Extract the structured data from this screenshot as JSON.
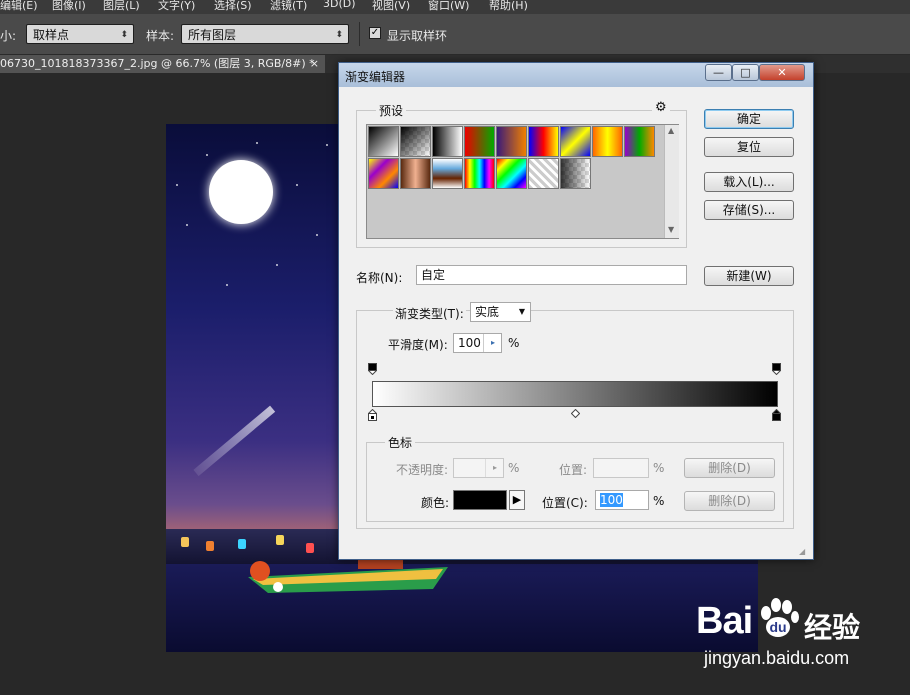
{
  "menubar": {
    "items": [
      "编辑(E)",
      "图像(I)",
      "图层(L)",
      "文字(Y)",
      "选择(S)",
      "滤镜(T)",
      "3D(D)",
      "视图(V)",
      "窗口(W)",
      "帮助(H)"
    ]
  },
  "options": {
    "size_label": "小:",
    "size_value": "取样点",
    "sample_label": "样本:",
    "sample_value": "所有图层",
    "show_ring_label": "显示取样环",
    "show_ring_checked": true
  },
  "document_tab": {
    "title": "06730_101818373367_2.jpg @ 66.7% (图层 3, RGB/8#) *",
    "close": "×"
  },
  "dialog": {
    "title": "渐变编辑器",
    "window_buttons": {
      "minimize": "—",
      "maximize": "□",
      "close": "✕"
    },
    "presets_label": "预设",
    "presets_gear": "⚙",
    "presets": [
      {
        "name": "foreground-to-background",
        "css": "linear-gradient(135deg,#000,#fff)"
      },
      {
        "name": "foreground-to-transparent",
        "css": "linear-gradient(135deg,#000,rgba(0,0,0,0))"
      },
      {
        "name": "black-white",
        "css": "linear-gradient(90deg,#000,#fff)"
      },
      {
        "name": "red-green",
        "css": "linear-gradient(90deg,#e00,#0a0)"
      },
      {
        "name": "violet-orange",
        "css": "linear-gradient(90deg,#3a1a7a,#f08000)"
      },
      {
        "name": "blue-red-yellow",
        "css": "linear-gradient(90deg,#00f,#f00,#ff0)"
      },
      {
        "name": "blue-yellow-blue",
        "css": "linear-gradient(135deg,#00f,#ff0,#00f)"
      },
      {
        "name": "orange-yellow-orange",
        "css": "linear-gradient(90deg,#f60,#ff0,#f60)"
      },
      {
        "name": "violet-green-orange",
        "css": "linear-gradient(90deg,#90c,#0a0,#f80)"
      },
      {
        "name": "yellow-violet-orange-blue",
        "css": "linear-gradient(135deg,#ff0,#90c,#f80,#00f)"
      },
      {
        "name": "copper",
        "css": "linear-gradient(90deg,#5a2a10,#f0b090,#5a2a10)"
      },
      {
        "name": "chrome",
        "css": "linear-gradient(180deg,#fff,#6ad,#620,#fff)"
      },
      {
        "name": "spectrum",
        "css": "linear-gradient(90deg,#f00,#ff0,#0f0,#0ff,#00f,#f0f,#f00)"
      },
      {
        "name": "transparent-rainbow",
        "css": "linear-gradient(135deg,#f00,#ff0,#0f0,#0ff,#00f,#f0f)"
      },
      {
        "name": "transparent-stripes",
        "css": "repeating-linear-gradient(45deg,#ccc 0 3px,#fff 3px 6px)"
      },
      {
        "name": "neutral-density",
        "css": "linear-gradient(90deg,rgba(0,0,0,.8),rgba(0,0,0,0))"
      }
    ],
    "buttons": {
      "ok": "确定",
      "reset": "复位",
      "load": "载入(L)...",
      "save": "存储(S)...",
      "new": "新建(W)"
    },
    "name_label": "名称(N):",
    "name_value": "自定",
    "gradient_type_label": "渐变类型(T):",
    "gradient_type_value": "实底",
    "smoothness_label": "平滑度(M):",
    "smoothness_value": "100",
    "percent": "%",
    "gradient": {
      "start_color": "#ffffff",
      "end_color": "#000000",
      "midpoint": 0.5
    },
    "color_stops": {
      "legend": "色标",
      "opacity_label": "不透明度:",
      "opacity_value": "",
      "opacity_position_label": "位置:",
      "opacity_position_value": "",
      "delete_label": "删除(D)",
      "color_label": "颜色:",
      "color_value": "#000000",
      "color_position_label": "位置(C):",
      "color_position_value": "100"
    }
  },
  "watermark": {
    "brand": "Bai",
    "brand_cn": "经验",
    "url": "jingyan.baidu.com"
  }
}
